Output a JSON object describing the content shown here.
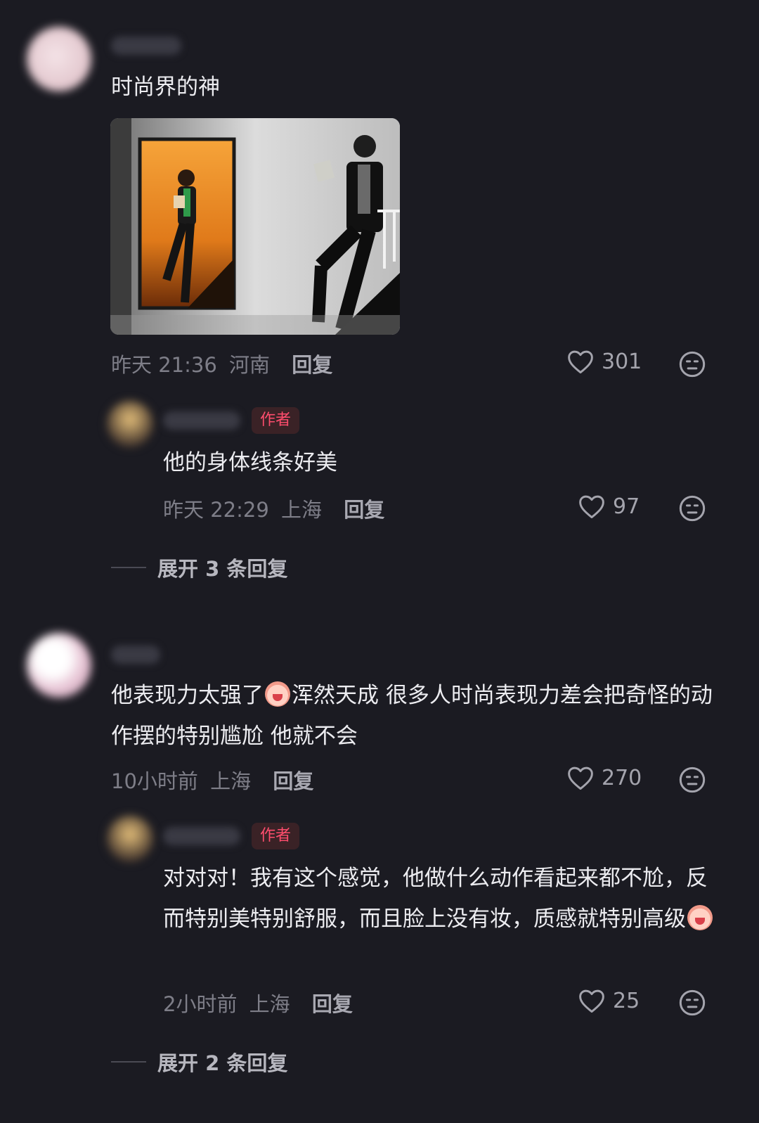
{
  "comments": [
    {
      "text": "时尚界的神",
      "time": "昨天 21:36",
      "location": "河南",
      "reply_label": "回复",
      "likes": "301",
      "reply": {
        "badge": "作者",
        "text": "他的身体线条好美",
        "time": "昨天 22:29",
        "location": "上海",
        "reply_label": "回复",
        "likes": "97"
      },
      "expand_label": "展开 3 条回复"
    },
    {
      "text_part1": "他表现力太强了",
      "text_part2": "浑然天成 很多人时尚表现力差会把奇怪的动作摆的特别尴尬 他就不会",
      "time": "10小时前",
      "location": "上海",
      "reply_label": "回复",
      "likes": "270",
      "reply": {
        "badge": "作者",
        "text": "对对对！我有这个感觉，他做什么动作看起来都不尬，反而特别美特别舒服，而且脸上没有妆，质感就特别高级",
        "time": "2小时前",
        "location": "上海",
        "reply_label": "回复",
        "likes": "25"
      },
      "expand_label": "展开 2 条回复"
    }
  ],
  "icons": {
    "like": "heart-outline-icon",
    "dislike": "meh-face-icon"
  },
  "colors": {
    "background": "#1b1b22",
    "author_badge_text": "#ff4d6d",
    "author_badge_bg": "#3a2226",
    "meta": "#7e7e88"
  }
}
